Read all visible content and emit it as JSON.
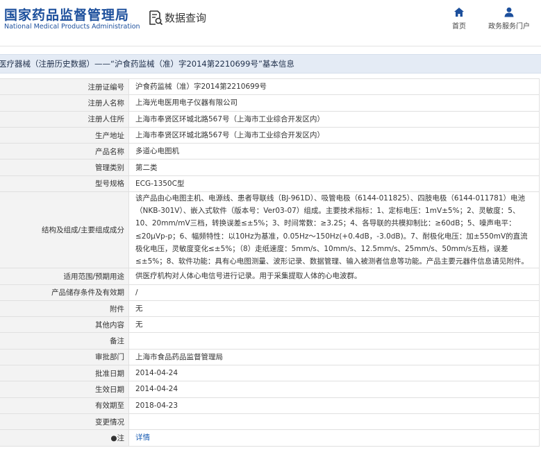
{
  "header": {
    "brand_cn": "国家药品监督管理局",
    "brand_en": "National Medical Products Administration",
    "query_label": "数据查询",
    "query_icon": "search-document-icon",
    "nav": [
      {
        "label": "首页",
        "icon": "home-icon"
      },
      {
        "label": "政务服务门户",
        "icon": "user-icon"
      }
    ],
    "accent_color": "#1c4f9c"
  },
  "title": "医疗器械（注册历史数据）——“沪食药监械（准）字2014第2210699号”基本信息",
  "rows": [
    {
      "label": "注册证编号",
      "value": "沪食药监械（准）字2014第2210699号"
    },
    {
      "label": "注册人名称",
      "value": "上海光电医用电子仪器有限公司"
    },
    {
      "label": "注册人住所",
      "value": "上海市奉贤区环城北路567号（上海市工业综合开发区内）"
    },
    {
      "label": "生产地址",
      "value": "上海市奉贤区环城北路567号（上海市工业综合开发区内）"
    },
    {
      "label": "产品名称",
      "value": "多道心电图机"
    },
    {
      "label": "管理类别",
      "value": "第二类"
    },
    {
      "label": "型号规格",
      "value": "ECG-1350C型"
    },
    {
      "label": "结构及组成/主要组成成分",
      "value": "该产品由心电图主机、电源线、患者导联线（BJ-961D）、吸管电极（6144-011825）、四肢电极（6144-011781）电池（NKB-301V）、嵌入式软件（版本号：Ver03-07）组成。主要技术指标：1、定标电压：1mV±5%；2、灵敏度：5、10、20mm/mV三档，转换误差≤±5%；3、时间常数：≥3.2S；4、各导联的共模抑制比：≥60dB；5、噪声电平：≤20μVp-p；6、幅频特性：以10Hz为基准，0.05Hz～150Hz(+0.4dB，-3.0dB)。7、耐极化电压：加±550mV的直流极化电压，灵敏度变化≤±5%；（8）走纸速度：5mm/s、10mm/s、12.5mm/s、25mm/s、50mm/s五档，误差≤±5%；8、软件功能：具有心电图测量、波形记录、数据管理、输入被测者信息等功能。产品主要元器件信息请见附件。"
    },
    {
      "label": "适用范围/预期用途",
      "value": "供医疗机构对人体心电信号进行记录。用于采集提取人体的心电波群。"
    },
    {
      "label": "产品储存条件及有效期",
      "value": "/"
    },
    {
      "label": "附件",
      "value": "无"
    },
    {
      "label": "其他内容",
      "value": "无"
    },
    {
      "label": "备注",
      "value": ""
    },
    {
      "label": "审批部门",
      "value": "上海市食品药品监督管理局"
    },
    {
      "label": "批准日期",
      "value": "2014-04-24"
    },
    {
      "label": "生效日期",
      "value": "2014-04-24"
    },
    {
      "label": "有效期至",
      "value": "2018-04-23"
    },
    {
      "label": "变更情况",
      "value": ""
    }
  ],
  "note": {
    "label": "●注",
    "link": "详情"
  }
}
